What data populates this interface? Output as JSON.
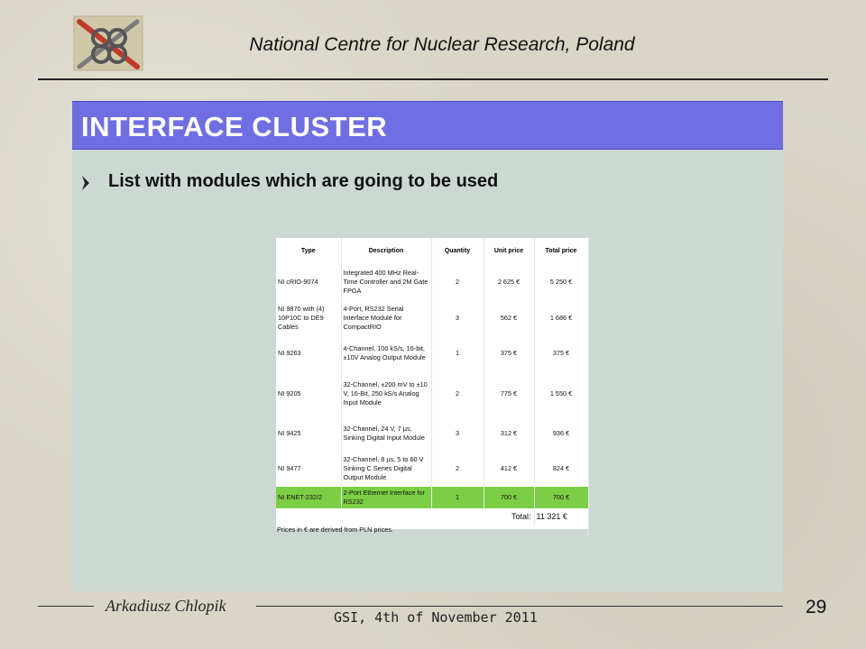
{
  "header": {
    "institution": "National Centre for Nuclear Research, Poland",
    "logo_icon": "ncbj-logo-icon"
  },
  "slide": {
    "title": "INTERFACE CLUSTER",
    "bullet": "List with modules which are going to be used",
    "bullet_icon": "bullet-arrow-icon",
    "colors": {
      "title_bar": "#6f6fe3",
      "panel": "#cdd8d3",
      "highlight_row": "#7ccf44"
    }
  },
  "table": {
    "headers": [
      "Type",
      "Description",
      "Quantity",
      "Unit price",
      "Total price"
    ],
    "rows": [
      [
        "NI cRIO-9074",
        "Integrated 400 MHz Real-Time Controller and 2M Gate FPGA",
        "2",
        "2 625 €",
        "5 250 €"
      ],
      [
        "NI 9870 with (4) 10P10C to DE9 Cables",
        "4-Port, RS232 Serial Interface Module for CompactRIO",
        "3",
        "562 €",
        "1 686 €"
      ],
      [
        "NI 9263",
        "4-Channel, 100 kS/s, 16-bit, ±10V Analog Output Module",
        "1",
        "375 €",
        "375 €"
      ],
      [
        "NI 9205",
        "32-Channel, ±200 mV to ±10 V, 16-Bit, 250 kS/s Analog Input Module",
        "2",
        "775 €",
        "1 550 €"
      ],
      [
        "NI 9425",
        "32-Channel, 24 V, 7 µs, Sinking Digital Input Module",
        "3",
        "312 €",
        "936 €"
      ],
      [
        "NI 9477",
        "32-Channel, 8 µs, 5 to 60 V Sinking C Series Digital Output Module",
        "2",
        "412 €",
        "824 €"
      ],
      [
        "NI ENET-232/2",
        "2-Port Ethernet Interface for RS232",
        "1",
        "700 €",
        "700 €"
      ]
    ],
    "highlight_row_index": 6,
    "total_label": "Total:",
    "total_value": "11 321 €",
    "note": "Prices in € are derived from PLN prices."
  },
  "footer": {
    "author": "Arkadiusz Chlopik",
    "event": "GSI, 4th of November 2011",
    "page_number": "29"
  }
}
